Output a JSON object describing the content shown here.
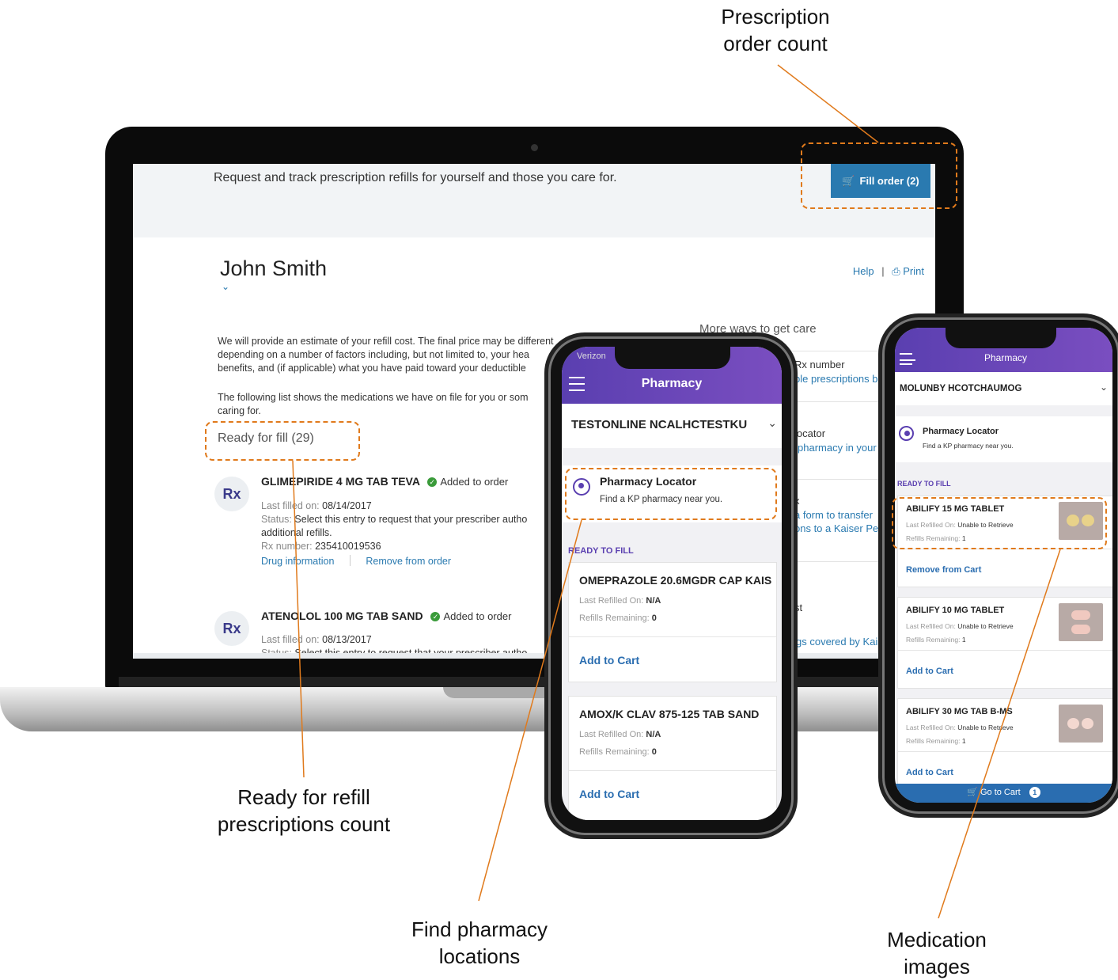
{
  "annotations": {
    "order_count": [
      "Prescription",
      "order count"
    ],
    "ready_count": [
      "Ready for refill",
      "prescriptions count"
    ],
    "find_pharmacy": [
      "Find pharmacy",
      "locations"
    ],
    "med_images": [
      "Medication",
      "images"
    ]
  },
  "desktop": {
    "lead": "Request and track prescription refills for yourself and those you care for.",
    "fill_order_label": "Fill order (2)",
    "member_name": "John Smith",
    "help": "Help",
    "print": "Print",
    "para1": "We will provide an estimate of your refill cost. The final price may be different\ndepending on a number of factors including, but not limited to, your hea\nbenefits, and (if applicable) what you have paid toward your deductible",
    "para2": "The following list shows the medications we have on file for you or som\ncaring for.",
    "ready_label": "Ready for fill (29)",
    "meds": [
      {
        "rx": "Rx",
        "name": "GLIMEPIRIDE 4 MG TAB TEVA",
        "added": "Added to order",
        "last_label": "Last filled on:",
        "last_value": "08/14/2017",
        "status_label": "Status:",
        "status_value": "Select this entry to request that your prescriber autho",
        "status_cont": "additional refills.",
        "rxnum_label": "Rx number:",
        "rxnum_value": "235410019536",
        "drug_info": "Drug information",
        "remove": "Remove from order"
      },
      {
        "rx": "Rx",
        "name": "ATENOLOL 100 MG TAB SAND",
        "added": "Added to order",
        "last_label": "Last filled on:",
        "last_value": "08/13/2017",
        "status_label": "Status:",
        "status_value": "Select this entry to request that your prescriber autho"
      }
    ],
    "side": {
      "title": "More ways to get care",
      "item1_t": "Rx number",
      "item1_l": "ble prescriptions b",
      "item2_t": "locator",
      "item2_l": "pharmacy in your",
      "item3_t": "x",
      "item3_l1": "a form to transfer",
      "item3_l2": "ons to a Kaiser Perm",
      "item4_t": "st",
      "item4_l": "gs covered by Kais"
    }
  },
  "phone1": {
    "carrier": "Verizon",
    "title": "Pharmacy",
    "pharmacy_select": "TESTONLINE NCALHCTESTKU",
    "locator_title": "Pharmacy Locator",
    "locator_sub": "Find a KP pharmacy near you.",
    "ready_label": "READY TO FILL",
    "cards": [
      {
        "name": "OMEPRAZOLE 20.6MGDR CAP KAIS",
        "last_label": "Last Refilled On:",
        "last_value": "N/A",
        "rem_label": "Refills Remaining:",
        "rem_value": "0",
        "action": "Add to Cart"
      },
      {
        "name": "AMOX/K CLAV 875-125 TAB SAND",
        "last_label": "Last Refilled On:",
        "last_value": "N/A",
        "rem_label": "Refills Remaining:",
        "rem_value": "0",
        "action": "Add to Cart"
      }
    ]
  },
  "phone2": {
    "title": "Pharmacy",
    "pharmacy_select": "MOLUNBY HCOTCHAUMOG",
    "locator_title": "Pharmacy Locator",
    "locator_sub": "Find a KP pharmacy near you.",
    "ready_label": "READY TO FILL",
    "cards": [
      {
        "name": "ABILIFY 15 MG TABLET",
        "last_label": "Last Refilled On:",
        "last_value": "Unable to Retrieve",
        "rem_label": "Refills Remaining:",
        "rem_value": "1",
        "action": "Remove from Cart"
      },
      {
        "name": "ABILIFY 10 MG TABLET",
        "last_label": "Last Refilled On:",
        "last_value": "Unable to Retrieve",
        "rem_label": "Refills Remaining:",
        "rem_value": "1",
        "action": "Add to Cart"
      },
      {
        "name": "ABILIFY 30 MG TAB B-MS",
        "last_label": "Last Refilled On:",
        "last_value": "Unable to Retrieve",
        "rem_label": "Refills Remaining:",
        "rem_value": "1",
        "action": "Add to Cart"
      }
    ],
    "cart_label": "Go to Cart",
    "cart_count": "1"
  },
  "colors": {
    "accent_orange": "#e07a1c",
    "kp_blue": "#2a7ab0",
    "pharmacy_purple": "#5a3fb0"
  }
}
